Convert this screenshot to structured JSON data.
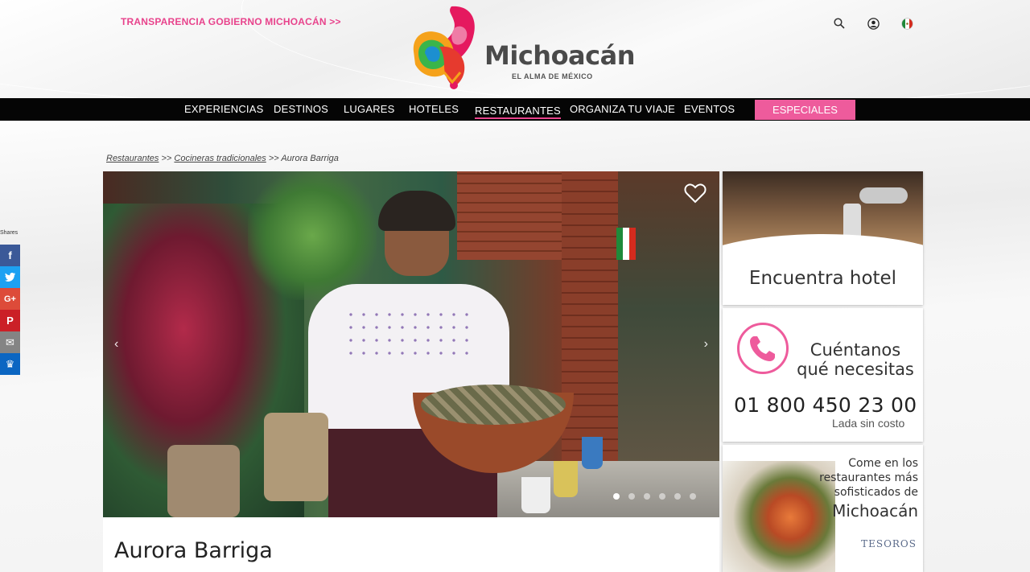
{
  "header": {
    "transparencia_link": "TRANSPARENCIA GOBIERNO MICHOACÁN >>",
    "brand": "Michoacán",
    "tagline": "EL ALMA DE MÉXICO",
    "icons": [
      "search-icon",
      "user-icon",
      "mexico-flag-icon"
    ]
  },
  "nav": {
    "items": [
      {
        "label": "EXPERIENCIAS"
      },
      {
        "label": "DESTINOS"
      },
      {
        "label": "LUGARES"
      },
      {
        "label": "HOTELES"
      },
      {
        "label": "RESTAURANTES",
        "active": true
      },
      {
        "label": "ORGANIZA TU VIAJE"
      },
      {
        "label": "EVENTOS"
      }
    ],
    "especiales": "ESPECIALES",
    "especiales_color": "#ee5b9c"
  },
  "breadcrumb": {
    "items": [
      "Restaurantes",
      "Cocineras tradicionales"
    ],
    "separator": ">>",
    "current": "Aurora Barriga"
  },
  "main": {
    "title": "Aurora Barriga",
    "carousel": {
      "slide_count": 6,
      "active_index": 0
    }
  },
  "sidebar": {
    "hotel_card": {
      "label": "Encuentra hotel"
    },
    "contact_card": {
      "title_line1": "Cuéntanos",
      "title_line2": "qué necesitas",
      "phone": "01 800 450 23 00",
      "subtitle": "Lada sin costo"
    },
    "restaurant_card": {
      "line1": "Come en los",
      "line2": "restaurantes más",
      "line3": "sofisticados de",
      "big": "Michoacán",
      "logo": "TESOROS"
    }
  },
  "share": {
    "label": "Shares",
    "buttons": [
      {
        "name": "facebook",
        "glyph": "f",
        "color": "#3b5998"
      },
      {
        "name": "twitter",
        "glyph": "t",
        "color": "#1da1f2"
      },
      {
        "name": "google-plus",
        "glyph": "G+",
        "color": "#dd4b39"
      },
      {
        "name": "pinterest",
        "glyph": "P",
        "color": "#cb2027"
      },
      {
        "name": "email",
        "glyph": "✉",
        "color": "#848484"
      },
      {
        "name": "sumome",
        "glyph": "♛",
        "color": "#0b66c2"
      }
    ]
  },
  "colors": {
    "accent": "#e8438c",
    "nav_bg": "#050505"
  }
}
